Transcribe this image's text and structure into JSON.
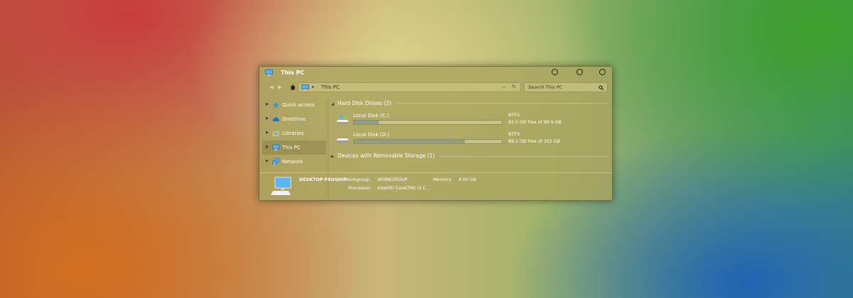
{
  "window": {
    "title": "This PC",
    "controls": [
      "minimize",
      "maximize",
      "close"
    ]
  },
  "toolbar": {
    "back_icon": "back-arrow-icon",
    "forward_icon": "forward-arrow-icon",
    "home_icon": "home-icon",
    "address": "This PC",
    "search_placeholder": "Search This PC"
  },
  "sidebar": {
    "items": [
      {
        "label": "Quick access",
        "icon": "star-icon"
      },
      {
        "label": "OneDrive",
        "icon": "cloud-icon"
      },
      {
        "label": "Libraries",
        "icon": "folder-icon"
      },
      {
        "label": "This PC",
        "icon": "computer-icon",
        "selected": true
      },
      {
        "label": "Network",
        "icon": "network-icon"
      }
    ]
  },
  "main": {
    "groups": [
      {
        "label": "Hard Disk Drives (2)"
      },
      {
        "label": "Devices with Removable Storage (1)"
      }
    ],
    "drives": [
      {
        "name": "Local Disk (C:)",
        "fs": "NTFS",
        "free_text": "83.0 GB free of 99.9 GB",
        "used_fraction": 0.17
      },
      {
        "name": "Local Disk (D:)",
        "fs": "NTFS",
        "free_text": "88.2 GB free of 352 GB",
        "used_fraction": 0.75
      }
    ]
  },
  "details": {
    "computer_name": "DESKTOP-F8UGHIF",
    "workgroup_label": "Workgroup:",
    "workgroup_value": "WORKGROUP",
    "memory_label": "Memory:",
    "memory_value": "4.00 GB",
    "processor_label": "Processor:",
    "processor_value": "Intel(R) Core(TM) i3 C..."
  },
  "colors": {
    "window_tint": "#aaa55f",
    "bar_fill": "#8e9f86",
    "accent_blue": "#3a8fd8"
  }
}
